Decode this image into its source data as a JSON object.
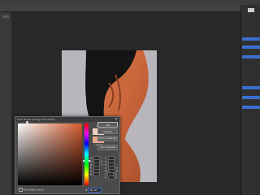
{
  "app": {
    "name": "Photoshop"
  },
  "dialog": {
    "title": "Color Picker (Foreground Color)",
    "buttons": {
      "ok": "OK",
      "cancel": "Cancel",
      "add_to_swatches": "Add to Swatches",
      "color_libraries": "Color Libraries"
    },
    "swatch_labels": {
      "new": "new",
      "current": "current"
    },
    "only_web_colors": "Only Web Colors",
    "fields": {
      "h": {
        "label": "H:",
        "unit": "°"
      },
      "s": {
        "label": "S:",
        "unit": "%"
      },
      "b": {
        "label": "B:",
        "unit": "%"
      },
      "r": {
        "label": "R:"
      },
      "g": {
        "label": "G:"
      },
      "b2": {
        "label": "B:"
      },
      "l": {
        "label": "L:"
      },
      "a": {
        "label": "a:"
      },
      "b3": {
        "label": "b:"
      },
      "c": {
        "label": "C:",
        "unit": "%"
      },
      "m": {
        "label": "M:",
        "unit": "%"
      },
      "y": {
        "label": "Y:",
        "unit": "%"
      },
      "k": {
        "label": "K:",
        "unit": "%"
      }
    },
    "hex_label": "#",
    "hex_value": "f8cdbf",
    "colors": {
      "new": "#efcfc0",
      "current": "#e9a58a",
      "hue_base": "#d3582a"
    }
  },
  "document": {
    "background_color": "#b9b5bd"
  }
}
